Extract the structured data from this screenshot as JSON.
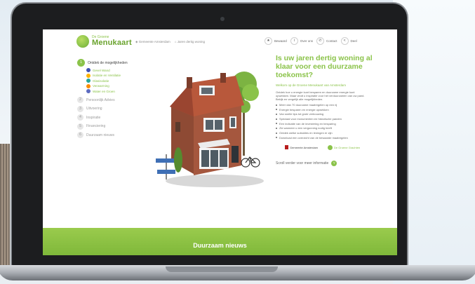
{
  "header": {
    "logo_small": "De Groene",
    "logo_big": "Menukaart",
    "links": [
      "Gemeente Amsterdam",
      "Jaren dertig woning"
    ],
    "nav": [
      {
        "label": "Bewaard",
        "icon": "star-icon"
      },
      {
        "label": "Over ons",
        "icon": "info-icon"
      },
      {
        "label": "Contact",
        "icon": "phone-icon"
      },
      {
        "label": "Deel",
        "icon": "share-icon"
      }
    ]
  },
  "sidebar": {
    "main_label": "Ontdek de mogelijkheden",
    "main_number": "1",
    "sub_items": [
      {
        "label": "Gevel Wand",
        "color": "#3f51b5"
      },
      {
        "label": "Isolatie en Ventilatie",
        "color": "#ffb300"
      },
      {
        "label": "Glasisolatie",
        "color": "#26a69a"
      },
      {
        "label": "Verwarming",
        "color": "#fb8c00"
      },
      {
        "label": "Water en Groen",
        "color": "#5c6bc0"
      }
    ],
    "items": [
      {
        "num": "2",
        "label": "Persoonlijk Advies"
      },
      {
        "num": "3",
        "label": "Uitvoering"
      },
      {
        "num": "4",
        "label": "Inspiratie"
      },
      {
        "num": "5",
        "label": "Financiering"
      },
      {
        "num": "6",
        "label": "Duurzaam nieuws"
      }
    ]
  },
  "content": {
    "headline": "Is uw jaren dertig woning al klaar voor een duurzame toekomst?",
    "welcome": "Welkom op de Groene Menukaart van Amsterdam",
    "intro": "Ontdek hoe u energie kunt besparen en duurzame energie kunt opwekken. Maar vindt u inspiratie voor het verduurzamen van uw pand. Bekijk en vergelijk alle mogelijkheden.",
    "bullets": [
      "Meer dan 70 duurzame maatregelen op een rij",
      "Energie besparen en energie opwekken",
      "Van snelle tips tot grote verbouwing",
      "Speciaal voor monumenten en historische panden",
      "Een indicatie van de investering en besparing",
      "Zie wanneer u een vergunning nodig heeft",
      "Ontdek welke subsidies en leningen er zijn",
      "Download een overzicht van de bewaarde maatregelen"
    ],
    "partner_a": "Gemeente Amsterdam",
    "partner_b": "De Groene Grachten",
    "scroll_text": "Scroll verder voor meer informatie",
    "scroll_icon": "chevron-down-icon"
  },
  "footer": {
    "title": "Duurzaam nieuws"
  },
  "colors": {
    "accent": "#8bc34a",
    "footer": "#8bc34a"
  }
}
